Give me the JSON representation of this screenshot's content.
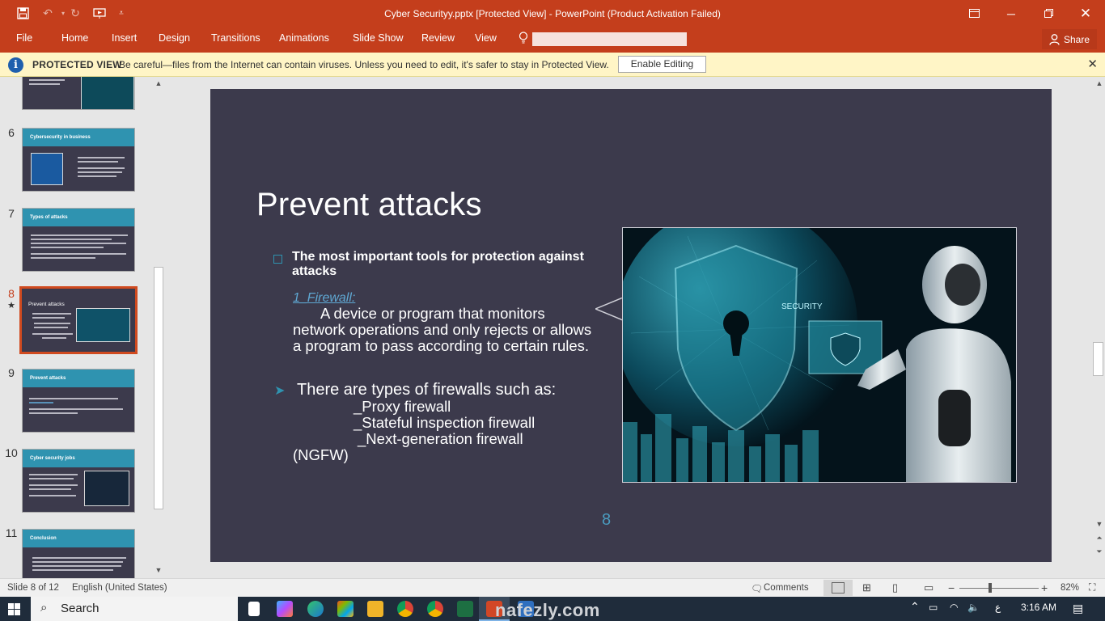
{
  "window": {
    "title": "Cyber Securityy.pptx [Protected View] - PowerPoint (Product Activation Failed)"
  },
  "ribbon": {
    "tabs": [
      "File",
      "Home",
      "Insert",
      "Design",
      "Transitions",
      "Animations",
      "Slide Show",
      "Review",
      "View"
    ],
    "share_label": "Share"
  },
  "protected_view": {
    "label": "PROTECTED VIEW",
    "message": "Be careful—files from the Internet can contain viruses. Unless you need to edit, it's safer to stay in Protected View.",
    "enable_button": "Enable Editing"
  },
  "thumbnails": [
    {
      "number": "",
      "title": "",
      "active": false
    },
    {
      "number": "6",
      "title": "Cybersecurity in business",
      "active": false
    },
    {
      "number": "7",
      "title": "Types of attacks",
      "active": false
    },
    {
      "number": "8",
      "title": "Prevent attacks",
      "active": true
    },
    {
      "number": "9",
      "title": "Prevent attacks",
      "active": false
    },
    {
      "number": "10",
      "title": "Cyber security jobs",
      "active": false
    },
    {
      "number": "11",
      "title": "Conclusion",
      "active": false
    }
  ],
  "slide": {
    "title": "Prevent attacks",
    "bullet1": "The most important tools for protection against attacks",
    "firewall_link": "1_Firewall:",
    "firewall_desc": "A device or program that monitors network operations and only rejects or allows a program to pass according to certain rules.",
    "bullet2": "There are types of firewalls such as:",
    "types": [
      "_Proxy firewall",
      "_Stateful inspection firewall",
      "_Next-generation firewall",
      "(NGFW)"
    ],
    "page_number": "8",
    "image_caption": "SECURITY"
  },
  "status": {
    "slide_info": "Slide 8 of 12",
    "language": "English (United States)",
    "comments": "Comments",
    "zoom": "82%"
  },
  "taskbar": {
    "search": "Search",
    "lang": "ع",
    "time": "3:16 AM"
  },
  "watermark": "nafezly.com",
  "colors": {
    "accent": "#c43e1c",
    "slide_bg": "#3c3a4c",
    "teal": "#2f93b0"
  }
}
